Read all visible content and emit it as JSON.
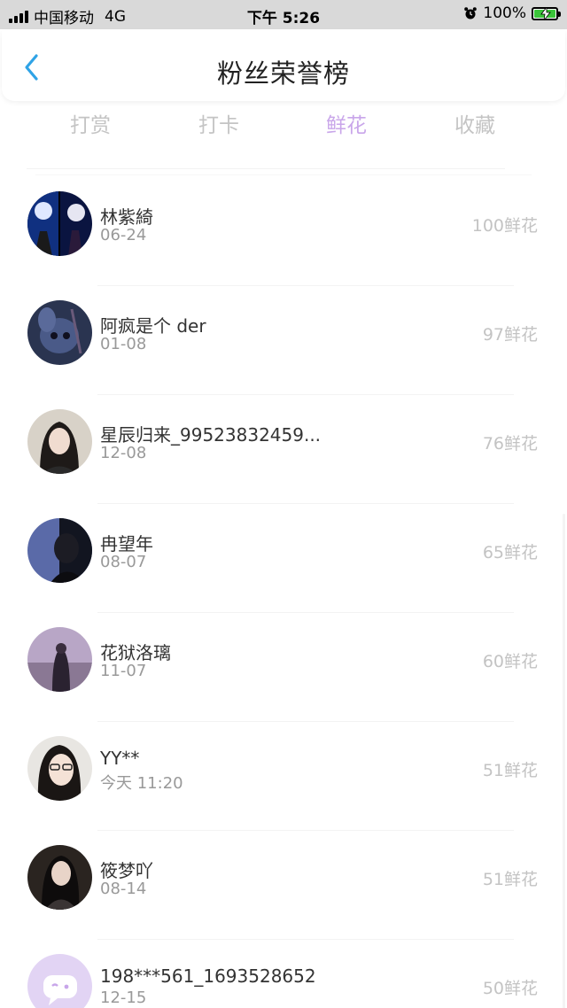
{
  "status_bar": {
    "carrier": "中国移动",
    "network": "4G",
    "time": "下午 5:26",
    "battery": "100%"
  },
  "header": {
    "title": "粉丝荣誉榜"
  },
  "tabs": [
    {
      "label": "打赏",
      "active": false
    },
    {
      "label": "打卡",
      "active": false
    },
    {
      "label": "鲜花",
      "active": true
    },
    {
      "label": "收藏",
      "active": false
    }
  ],
  "list": [
    {
      "name": "林紫綺",
      "date": "06-24",
      "count": "100鲜花"
    },
    {
      "name": "阿疯是个 der",
      "date": "01-08",
      "count": "97鲜花"
    },
    {
      "name": "星辰归来_99523832459...",
      "date": "12-08",
      "count": "76鲜花"
    },
    {
      "name": "冉望年",
      "date": "08-07",
      "count": "65鲜花"
    },
    {
      "name": "花狱洛璃",
      "date": "11-07",
      "count": "60鲜花"
    },
    {
      "name": "YY**",
      "date": "今天 11:20",
      "count": "51鲜花"
    },
    {
      "name": "筱梦吖",
      "date": "08-14",
      "count": "51鲜花"
    },
    {
      "name": "198***561_1693528652",
      "date": "12-15",
      "count": "50鲜花"
    }
  ],
  "colors": {
    "active_tab": "#c9a6ea",
    "inactive_tab": "#c4c4c4",
    "back_arrow": "#2fa3e6",
    "battery": "#3bc43a"
  }
}
